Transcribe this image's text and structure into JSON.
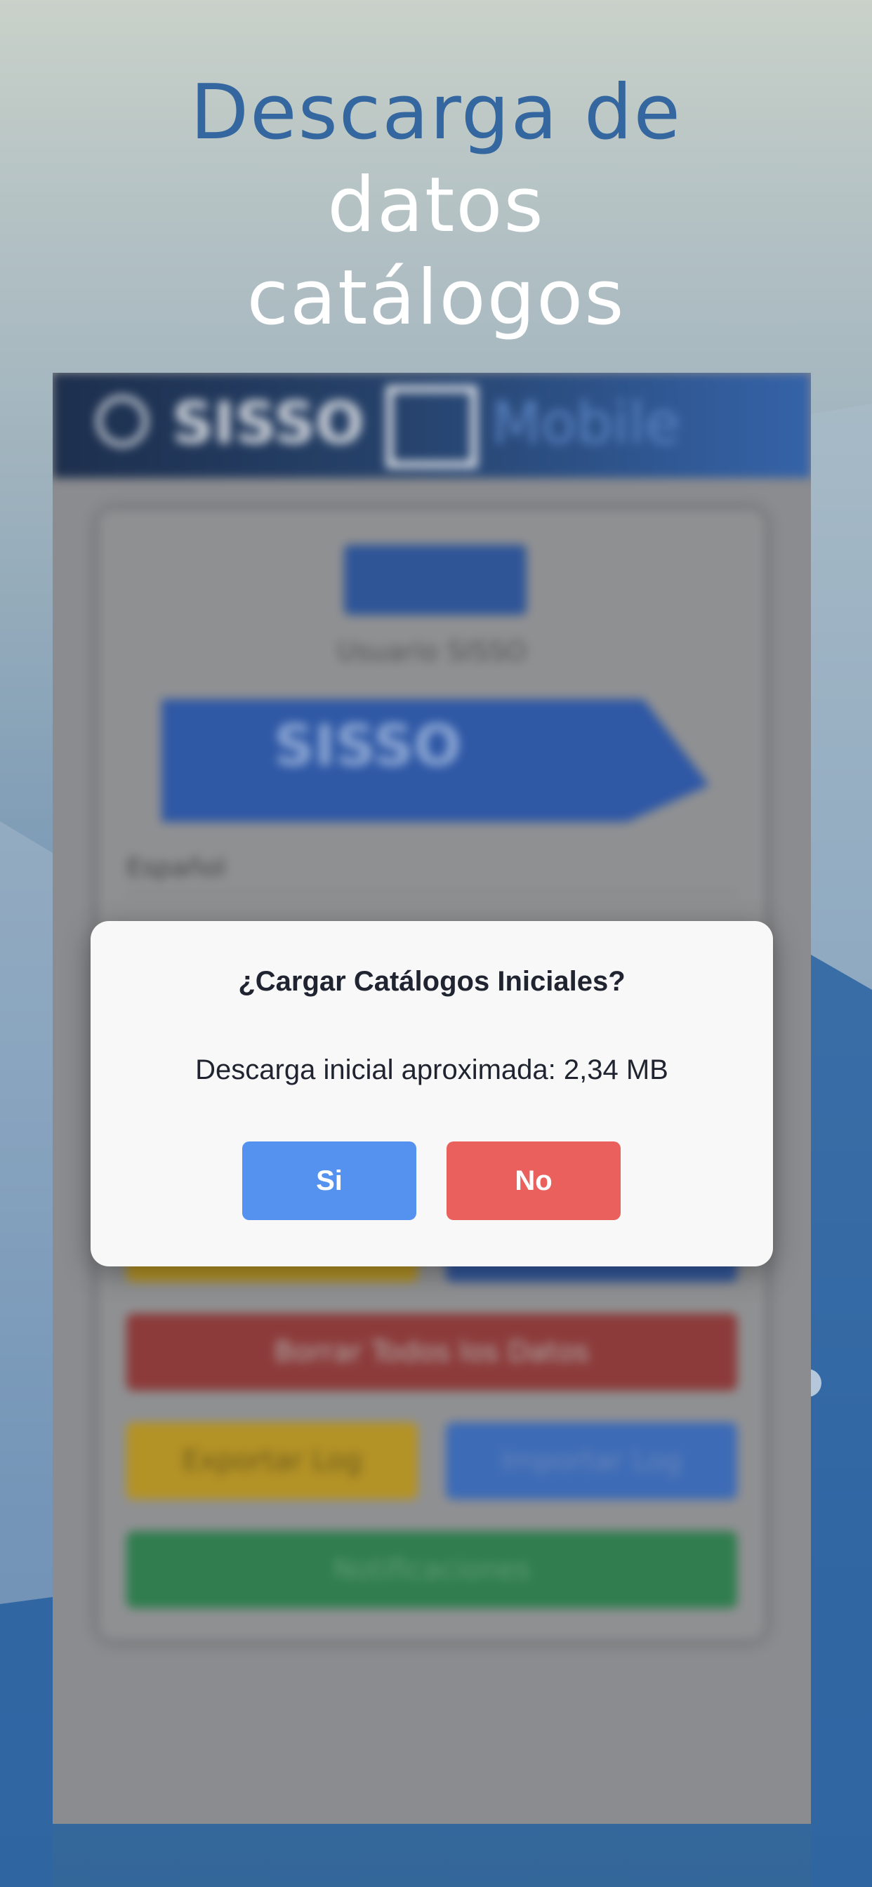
{
  "heading": {
    "line1": "Descarga de",
    "line2": "datos",
    "line3": "catálogos"
  },
  "colors": {
    "heading_accent": "#34669f",
    "yes_button": "#5592ef",
    "no_button": "#e9605c",
    "app_bar": "#26426b"
  },
  "app": {
    "header": {
      "brand_left": "SISSO",
      "brand_right": "Mobile",
      "icons": [
        "power-icon",
        "sisso-logo-icon"
      ]
    },
    "card": {
      "pill": "",
      "user": "Usuario SISSO",
      "banner": "SISSO",
      "language": "Español"
    },
    "buttons": {
      "delete_all": "Borrar Todos los Datos",
      "export_log": "Exportar Log",
      "import_log": "Importar Log",
      "notifications": "Notificaciones"
    }
  },
  "dialog": {
    "title": "¿Cargar Catálogos Iniciales?",
    "message": "Descarga inicial aproximada: 2,34 MB",
    "yes_label": "Si",
    "no_label": "No"
  }
}
